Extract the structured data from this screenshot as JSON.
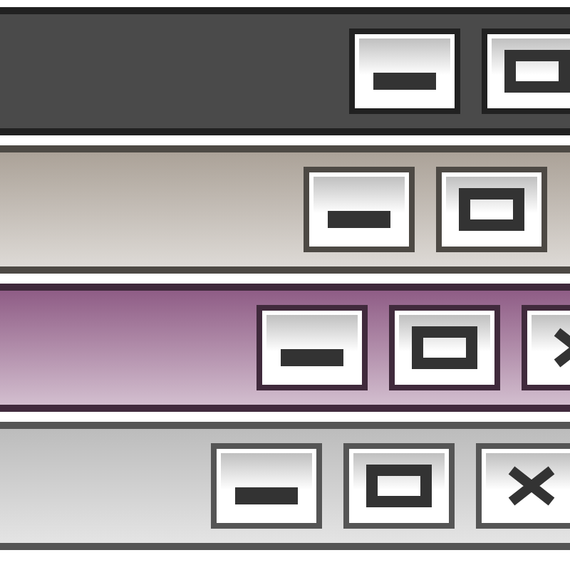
{
  "title_bars": [
    {
      "color": "#4a4a4a",
      "gradient": false,
      "buttons": [
        {
          "kind": "minimize"
        },
        {
          "kind": "maximize"
        }
      ]
    },
    {
      "color": "#aba298",
      "gradient": true,
      "buttons": [
        {
          "kind": "minimize"
        },
        {
          "kind": "maximize"
        }
      ]
    },
    {
      "color": "#8f5d86",
      "gradient": true,
      "buttons": [
        {
          "kind": "minimize"
        },
        {
          "kind": "maximize"
        },
        {
          "kind": "close"
        }
      ]
    },
    {
      "color": "#bcbcbc",
      "gradient": true,
      "buttons": [
        {
          "kind": "minimize"
        },
        {
          "kind": "maximize"
        },
        {
          "kind": "close"
        }
      ]
    }
  ]
}
